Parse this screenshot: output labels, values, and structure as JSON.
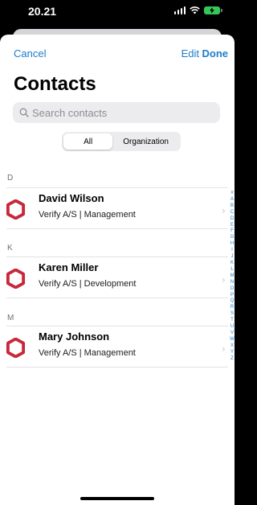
{
  "status": {
    "time": "20.21"
  },
  "nav": {
    "cancel": "Cancel",
    "edit": "Edit",
    "done": "Done"
  },
  "title": "Contacts",
  "search": {
    "placeholder": "Search contacts"
  },
  "segments": {
    "all": "All",
    "organization": "Organization"
  },
  "sections": [
    {
      "letter": "D",
      "contact": {
        "name": "David Wilson",
        "subtitle": "Verify A/S | Management"
      }
    },
    {
      "letter": "K",
      "contact": {
        "name": "Karen Miller",
        "subtitle": "Verify A/S | Development"
      }
    },
    {
      "letter": "M",
      "contact": {
        "name": "Mary Johnson",
        "subtitle": "Verify A/S | Management"
      }
    }
  ],
  "index": [
    "#",
    "A",
    "B",
    "C",
    "D",
    "E",
    "F",
    "G",
    "H",
    "I",
    "J",
    "K",
    "L",
    "M",
    "N",
    "O",
    "P",
    "Q",
    "R",
    "S",
    "T",
    "U",
    "V",
    "W",
    "X",
    "Y",
    "Z"
  ],
  "colors": {
    "accent": "#1a7dcb",
    "logo_red": "#c7283a"
  }
}
